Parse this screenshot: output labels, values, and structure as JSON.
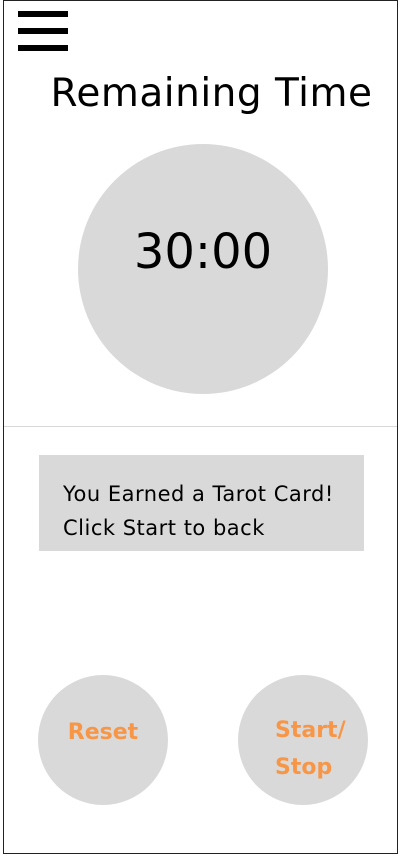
{
  "header": {
    "menu_icon": "hamburger-menu-icon",
    "title": "Remaining Time"
  },
  "timer": {
    "display": "30:00"
  },
  "message": {
    "line1": "You Earned a Tarot Card!",
    "line2": "Click Start to back"
  },
  "controls": {
    "reset_label": "Reset",
    "start_label_line1": "Start/",
    "start_label_line2": "Stop"
  },
  "colors": {
    "button_text": "#f79646",
    "circle_fill": "#d9d9d9"
  }
}
